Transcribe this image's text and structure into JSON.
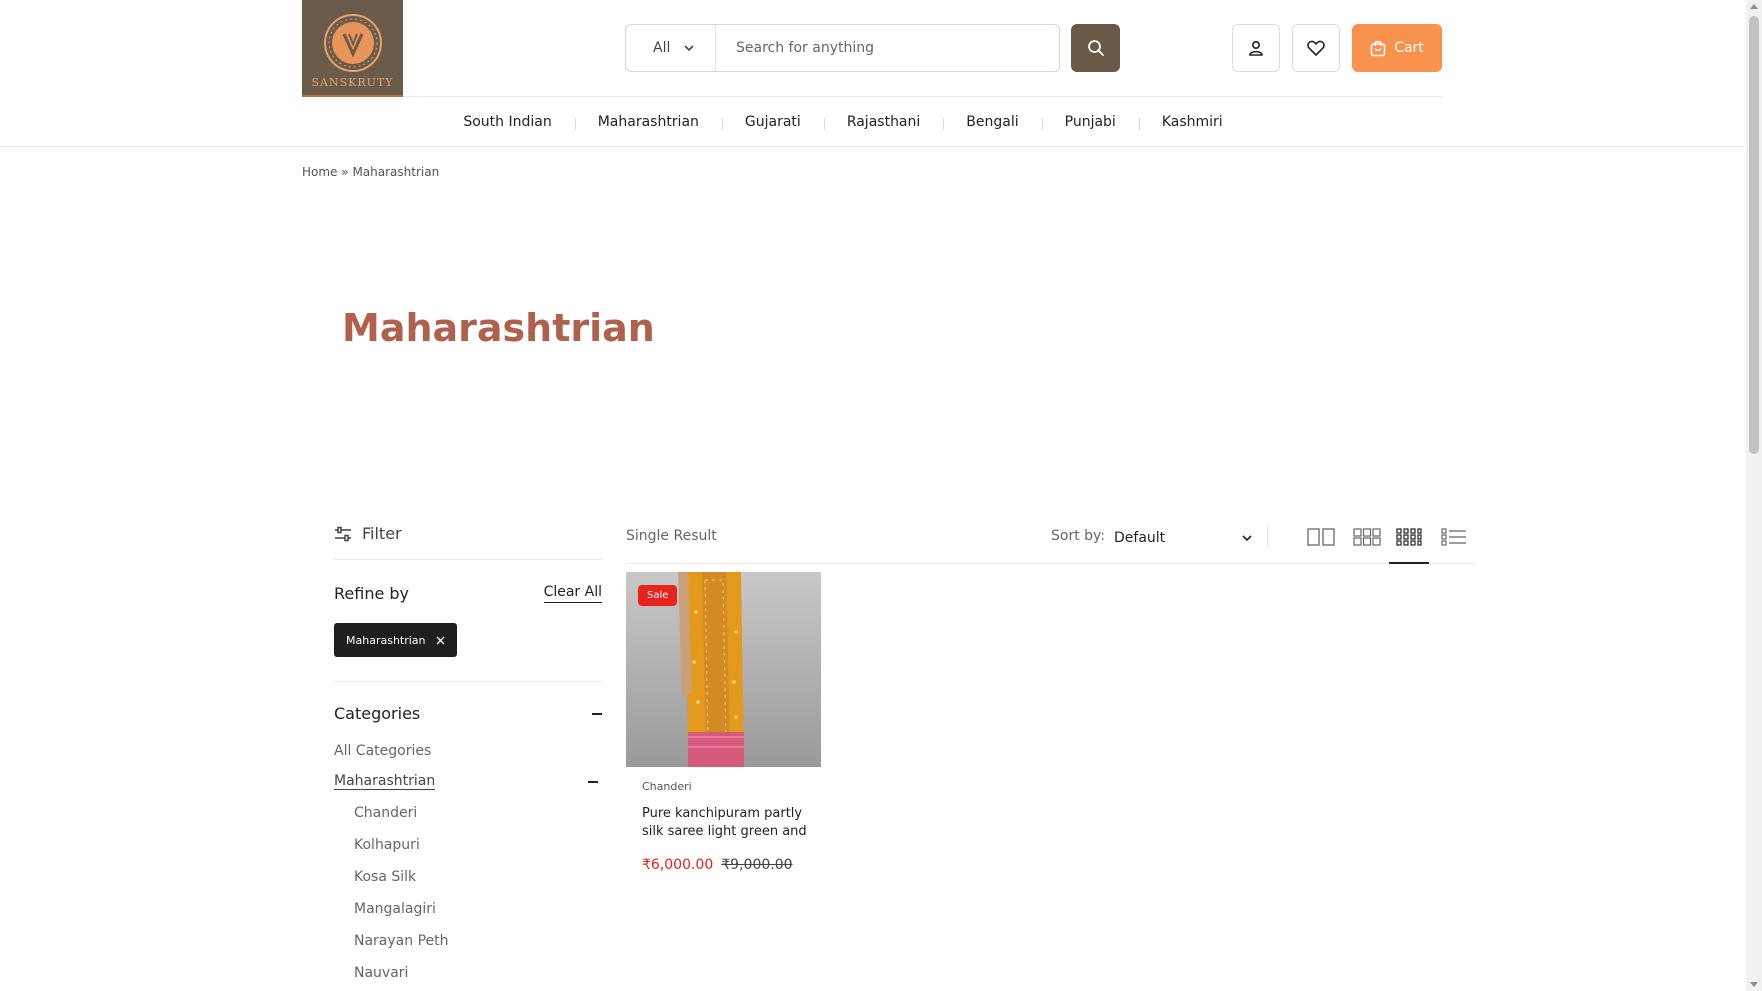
{
  "brand": {
    "logo_text": "SANSKRUTY"
  },
  "search": {
    "category": "All",
    "placeholder": "Search for anything"
  },
  "header": {
    "cart_label": "Cart"
  },
  "nav": {
    "items": [
      "South Indian",
      "Maharashtrian",
      "Gujarati",
      "Rajasthani",
      "Bengali",
      "Punjabi",
      "Kashmiri"
    ]
  },
  "breadcrumb": {
    "home": "Home",
    "separator": "»",
    "current": "Maharashtrian"
  },
  "page": {
    "title": "Maharashtrian"
  },
  "sidebar": {
    "filter_label": "Filter",
    "refine_title": "Refine by",
    "clear_all": "Clear All",
    "active_chip": "Maharashtrian",
    "categories_title": "Categories",
    "all_categories": "All Categories",
    "current_category": "Maharashtrian",
    "subcategories": [
      "Chanderi",
      "Kolhapuri",
      "Kosa Silk",
      "Mangalagiri",
      "Narayan Peth",
      "Nauvari"
    ]
  },
  "toolbar": {
    "result_count": "Single Result",
    "sort_label": "Sort by:",
    "sort_value": "Default"
  },
  "products": [
    {
      "badge": "Sale",
      "category": "Chanderi",
      "title": "Pure kanchipuram partly silk saree light green and",
      "price": "₹6,000.00",
      "old_price": "₹9,000.00"
    }
  ],
  "colors": {
    "accent": "#f9924d",
    "title": "#b0614e",
    "search_button": "#6b5947",
    "sale": "#e8231d",
    "logo_bg": "#6b5b4b"
  }
}
